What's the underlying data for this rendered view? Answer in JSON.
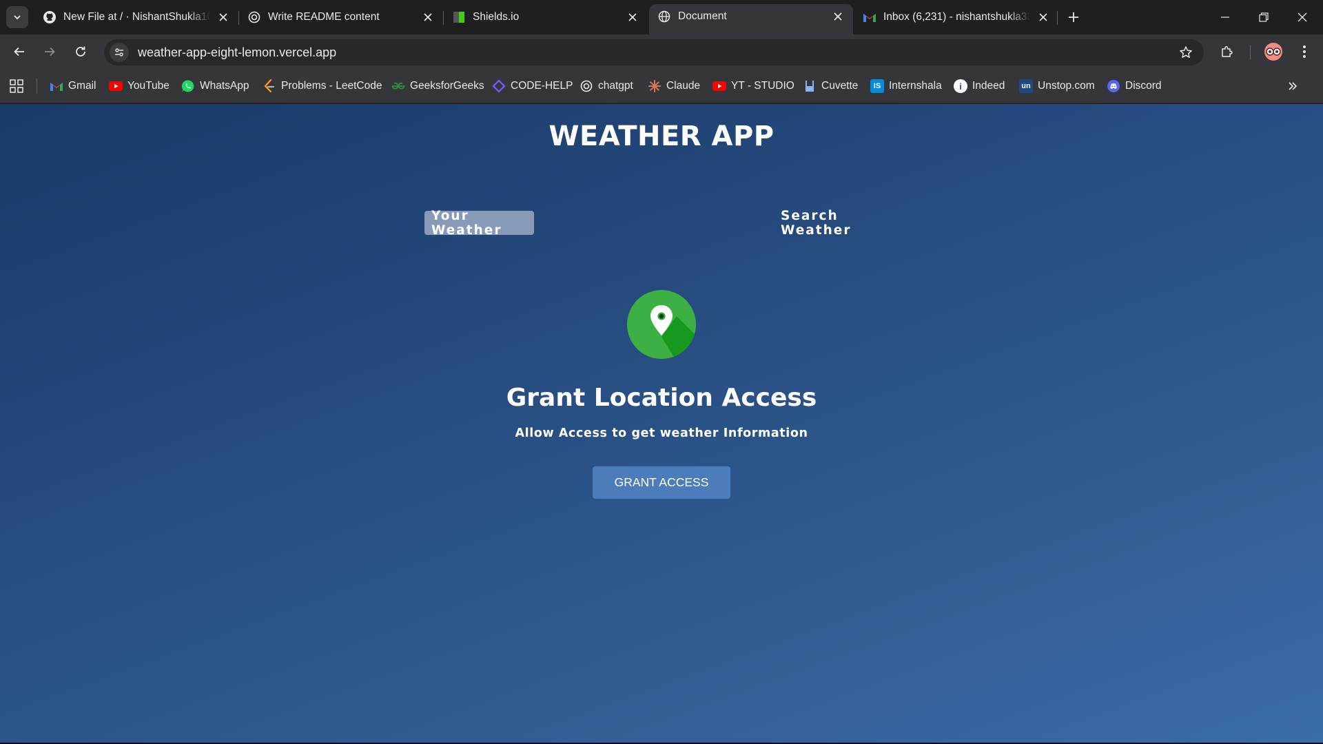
{
  "browser": {
    "tabs": [
      {
        "title": "New File at / · NishantShukla10/",
        "icon": "github-icon",
        "active": false
      },
      {
        "title": "Write README content",
        "icon": "chatgpt-icon",
        "active": false
      },
      {
        "title": "Shields.io",
        "icon": "shields-icon",
        "active": false
      },
      {
        "title": "Document",
        "icon": "globe-icon",
        "active": true
      },
      {
        "title": "Inbox (6,231) - nishantshukla33",
        "icon": "gmail-icon",
        "active": false
      }
    ],
    "url": "weather-app-eight-lemon.vercel.app",
    "bookmarks": [
      {
        "label": "Gmail",
        "icon": "gmail-icon",
        "color": "#ea4335"
      },
      {
        "label": "YouTube",
        "icon": "youtube-icon",
        "color": "#ff0000"
      },
      {
        "label": "WhatsApp",
        "icon": "whatsapp-icon",
        "color": "#25d366"
      },
      {
        "label": "Problems - LeetCode",
        "icon": "leetcode-icon",
        "color": "#ffa116"
      },
      {
        "label": "GeeksforGeeks",
        "icon": "geeksforgeeks-icon",
        "color": "#2f8d46"
      },
      {
        "label": "CODE-HELP",
        "icon": "codehelp-icon",
        "color": "#7b5cff"
      },
      {
        "label": "chatgpt",
        "icon": "chatgpt-icon",
        "color": "#e8eaed"
      },
      {
        "label": "Claude",
        "icon": "claude-icon",
        "color": "#d97757"
      },
      {
        "label": "YT - STUDIO",
        "icon": "youtube-studio-icon",
        "color": "#ff0000"
      },
      {
        "label": "Cuvette",
        "icon": "cuvette-icon",
        "color": "#8ab4f8"
      },
      {
        "label": "Internshala",
        "icon": "internshala-icon",
        "color": "#008bdc"
      },
      {
        "label": "Indeed",
        "icon": "indeed-icon",
        "color": "#ffffff"
      },
      {
        "label": "Unstop.com",
        "icon": "unstop-icon",
        "color": "#1c4980"
      },
      {
        "label": "Discord",
        "icon": "discord-icon",
        "color": "#5865f2"
      }
    ]
  },
  "app": {
    "title": "WEATHER APP",
    "tabs": {
      "your_weather": "Your Weather",
      "search_weather": "Search Weather"
    },
    "grant": {
      "heading": "Grant Location Access",
      "subtext": "Allow Access to get weather Information",
      "button": "GRANT ACCESS"
    },
    "colors": {
      "accent_button": "#4c7cba",
      "location_icon_green": "#3cb043"
    }
  }
}
